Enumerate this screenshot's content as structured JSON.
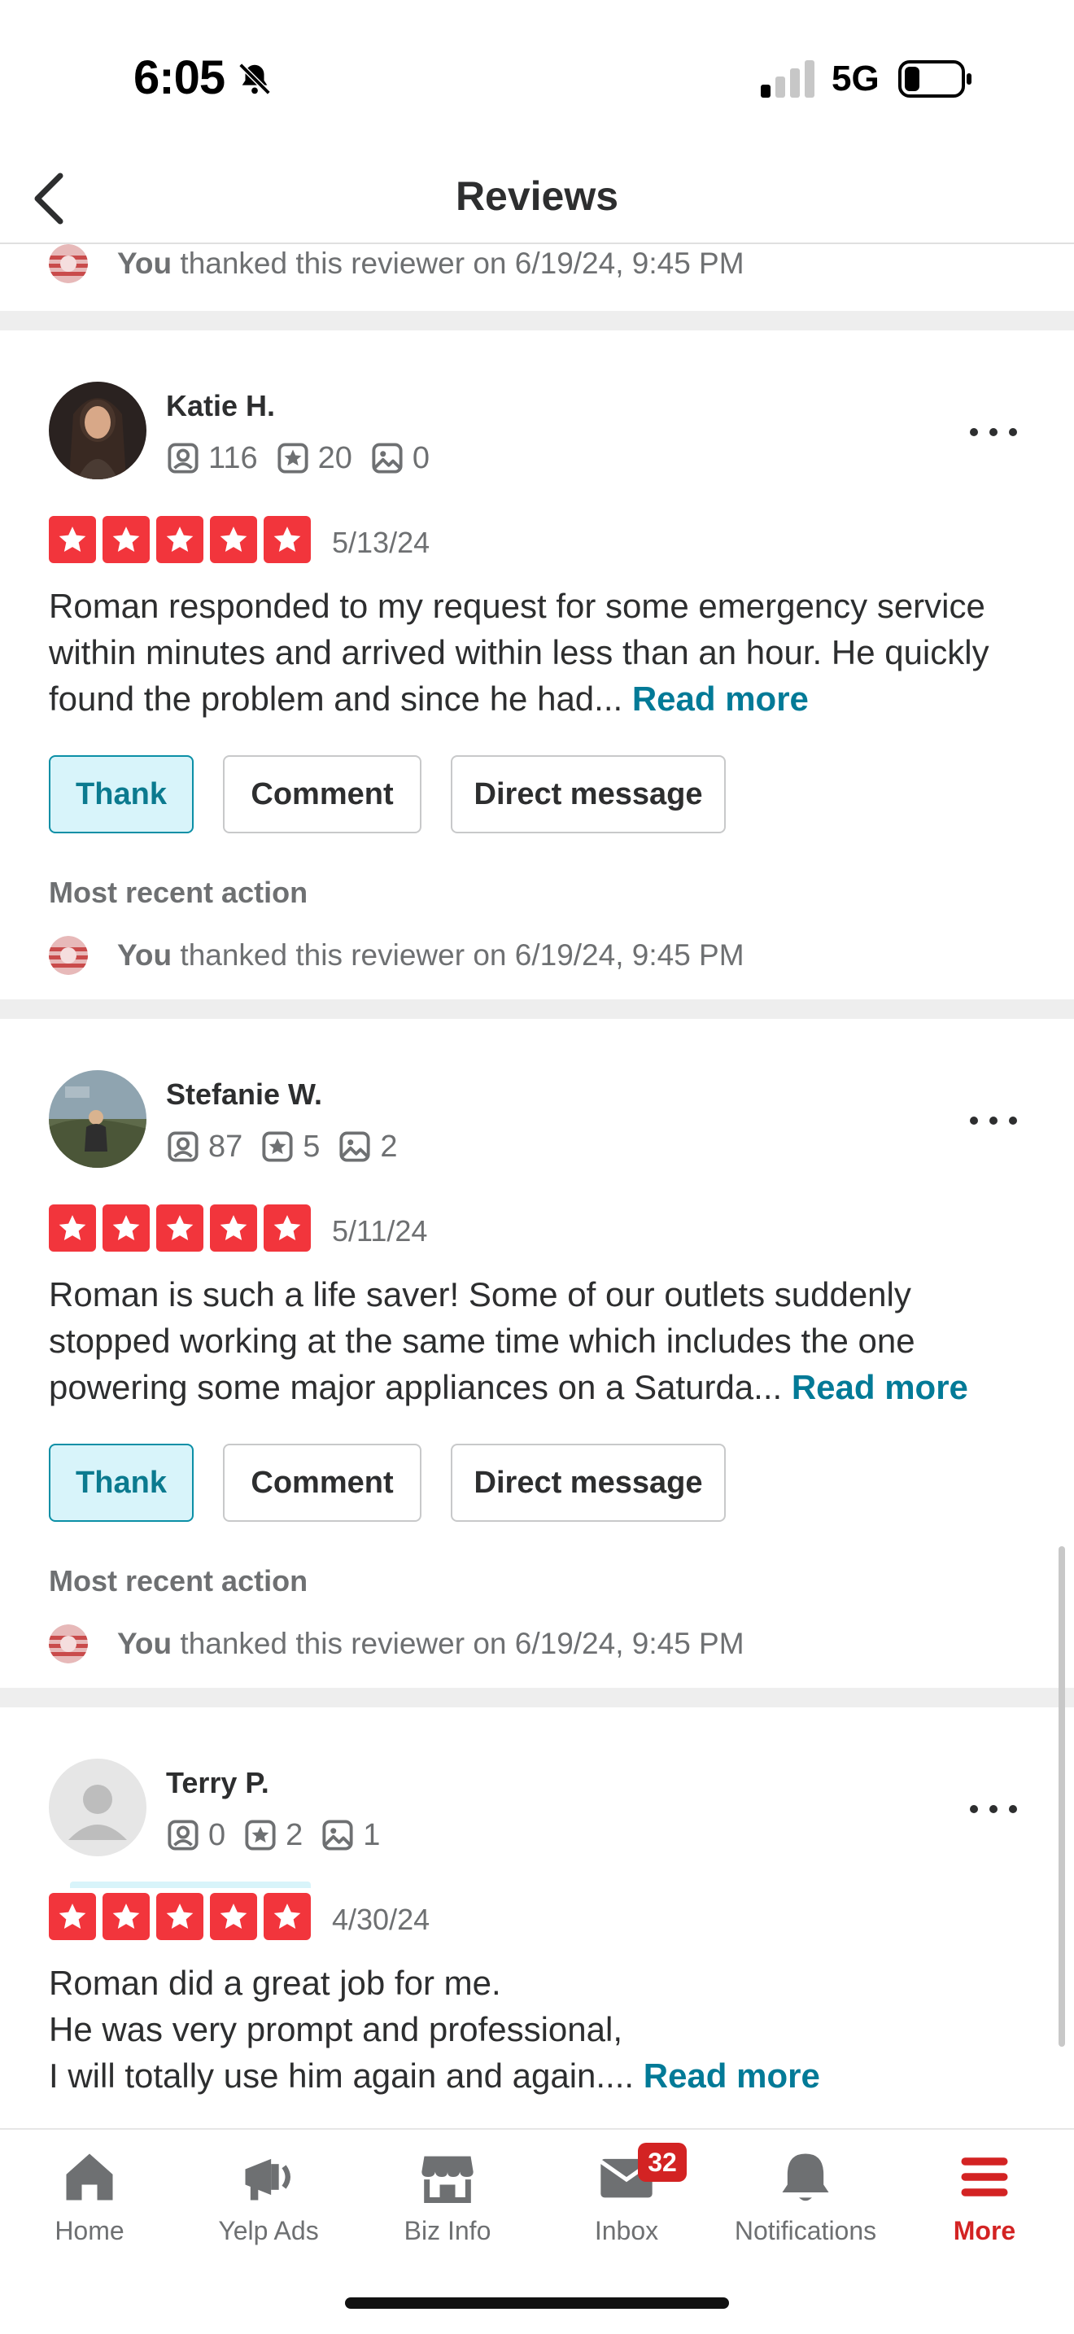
{
  "status_bar": {
    "time": "6:05",
    "network": "5G"
  },
  "header": {
    "title": "Reviews"
  },
  "top_action": {
    "you": "You",
    "text": " thanked this reviewer on 6/19/24, 9:45 PM"
  },
  "reviews": [
    {
      "name": "Katie H.",
      "friends": "116",
      "reviews_count": "20",
      "photos": "0",
      "rating": 5,
      "date": "5/13/24",
      "text": "Roman responded to my request for some emergency service within minutes and arrived within less than an hour. He quickly found the problem and since he had... ",
      "read_more": "Read more",
      "thank_label": "Thank",
      "comment_label": "Comment",
      "dm_label": "Direct message",
      "recent_label": "Most recent action",
      "action_you": "You",
      "action_text": " thanked this reviewer on 6/19/24, 9:45 PM"
    },
    {
      "name": "Stefanie W.",
      "friends": "87",
      "reviews_count": "5",
      "photos": "2",
      "rating": 5,
      "date": "5/11/24",
      "text": "Roman is such a life saver! Some of our outlets suddenly stopped working at the same time which includes the one powering  some major appliances on a Saturda... ",
      "read_more": "Read more",
      "thank_label": "Thank",
      "comment_label": "Comment",
      "dm_label": "Direct message",
      "recent_label": "Most recent action",
      "action_you": "You",
      "action_text": " thanked this reviewer on 6/19/24, 9:45 PM"
    },
    {
      "name": "Terry P.",
      "friends": "0",
      "reviews_count": "2",
      "photos": "1",
      "rating": 5,
      "date": "4/30/24",
      "text": "Roman did a great job for me.\nHe was very prompt and professional,\nI will totally use him again and again.... ",
      "read_more": "Read more"
    }
  ],
  "bottom_nav": {
    "items": [
      {
        "label": "Home",
        "icon": "home-icon"
      },
      {
        "label": "Yelp Ads",
        "icon": "megaphone-icon"
      },
      {
        "label": "Biz Info",
        "icon": "storefront-icon"
      },
      {
        "label": "Inbox",
        "icon": "inbox-icon",
        "badge": "32"
      },
      {
        "label": "Notifications",
        "icon": "bell-icon"
      },
      {
        "label": "More",
        "icon": "menu-icon",
        "active": true
      }
    ]
  },
  "colors": {
    "yelp_red": "#d32323",
    "star_red": "#f2353c",
    "link_teal": "#027a97",
    "thank_bg": "#d8f4fa"
  }
}
